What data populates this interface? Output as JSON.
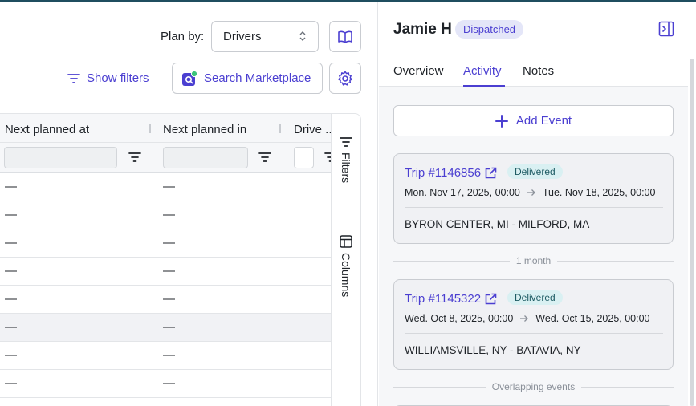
{
  "toolbar": {
    "plan_by_label": "Plan by:",
    "plan_by_value": "Drivers",
    "show_filters_label": "Show filters",
    "search_marketplace_label": "Search Marketplace"
  },
  "grid": {
    "columns": [
      "Next planned at",
      "Next planned in",
      "Drive ..."
    ],
    "rows": [
      [
        "—",
        "—"
      ],
      [
        "—",
        "—"
      ],
      [
        "—",
        "—"
      ],
      [
        "—",
        "—"
      ],
      [
        "—",
        "—"
      ],
      [
        "—",
        "—"
      ],
      [
        "—",
        "—"
      ],
      [
        "—",
        "—"
      ],
      [
        "—",
        "—"
      ]
    ],
    "highlighted_row_index": 5
  },
  "side_tabs": {
    "filters_label": "Filters",
    "columns_label": "Columns"
  },
  "detail": {
    "name": "Jamie H",
    "status": "Dispatched",
    "tabs": [
      "Overview",
      "Activity",
      "Notes"
    ],
    "active_tab": "Activity",
    "add_event_label": "Add Event",
    "events": [
      {
        "trip": "Trip #1146856",
        "status": "Delivered",
        "start": "Mon. Nov 17, 2025, 00:00",
        "end": "Tue. Nov 18, 2025, 00:00",
        "route": "BYRON CENTER, MI - MILFORD, MA"
      },
      {
        "trip": "Trip #1145322",
        "status": "Delivered",
        "start": "Wed. Oct 8, 2025, 00:00",
        "end": "Wed. Oct 15, 2025, 00:00",
        "route": "WILLIAMSVILLE, NY - BATAVIA, NY"
      }
    ],
    "dividers": [
      "1 month",
      "Overlapping events"
    ]
  },
  "colors": {
    "accent": "#4b3fd1",
    "delivered_bg": "#d9f0f2",
    "dispatched_bg": "#e4e6f8"
  }
}
